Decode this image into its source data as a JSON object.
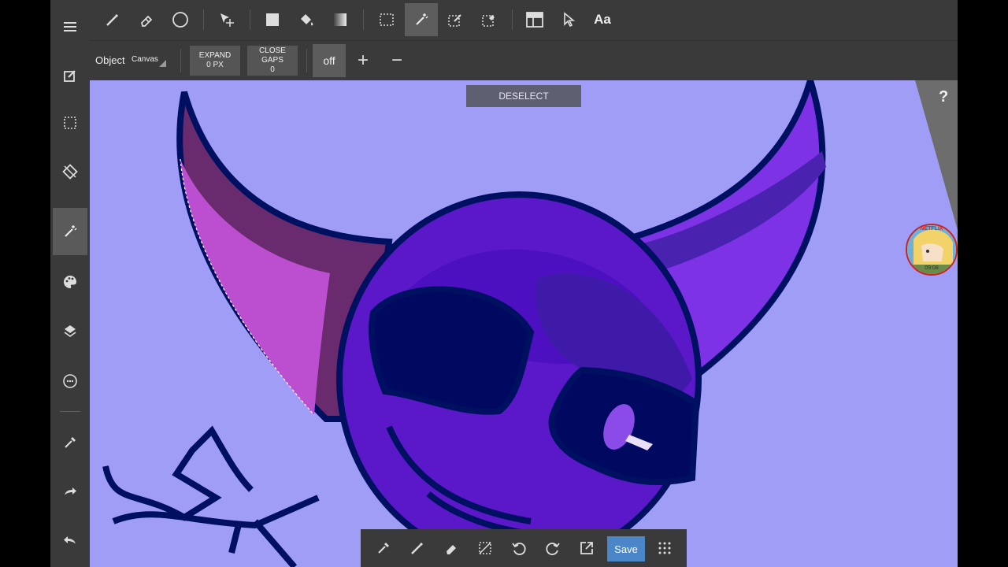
{
  "toolbar": {
    "tools": [
      "brush",
      "eraser",
      "ellipse",
      "move",
      "rectangle-fill",
      "fill-bucket",
      "gradient",
      "select-rect",
      "magic-wand",
      "select-pen",
      "select-eraser",
      "frame-divider",
      "operation",
      "text"
    ],
    "text_tool_label": "Aa",
    "active_tool": "magic-wand"
  },
  "options": {
    "object_label": "Object",
    "object_value": "Canvas",
    "expand_label": "EXPAND",
    "expand_value": "0 PX",
    "close_gaps_label": "CLOSE",
    "close_gaps_label2": "GAPS",
    "close_gaps_value": "0",
    "antialias_value": "off",
    "plus": "+",
    "minus": "−"
  },
  "sidebar": {
    "items": [
      "menu",
      "edit",
      "selection",
      "transform",
      "magic-wand",
      "palette",
      "layers",
      "smudge",
      "eyedropper",
      "redo",
      "undo"
    ],
    "active": "magic-wand"
  },
  "canvas": {
    "deselect_label": "DESELECT",
    "help_label": "?",
    "background": "#a09df7"
  },
  "overlay": {
    "brand": "NETFLIX",
    "time": "09:08"
  },
  "bottom_bar": {
    "items": [
      "eyedropper",
      "pen",
      "eraser",
      "deselect",
      "undo",
      "redo",
      "export"
    ],
    "save_label": "Save"
  }
}
